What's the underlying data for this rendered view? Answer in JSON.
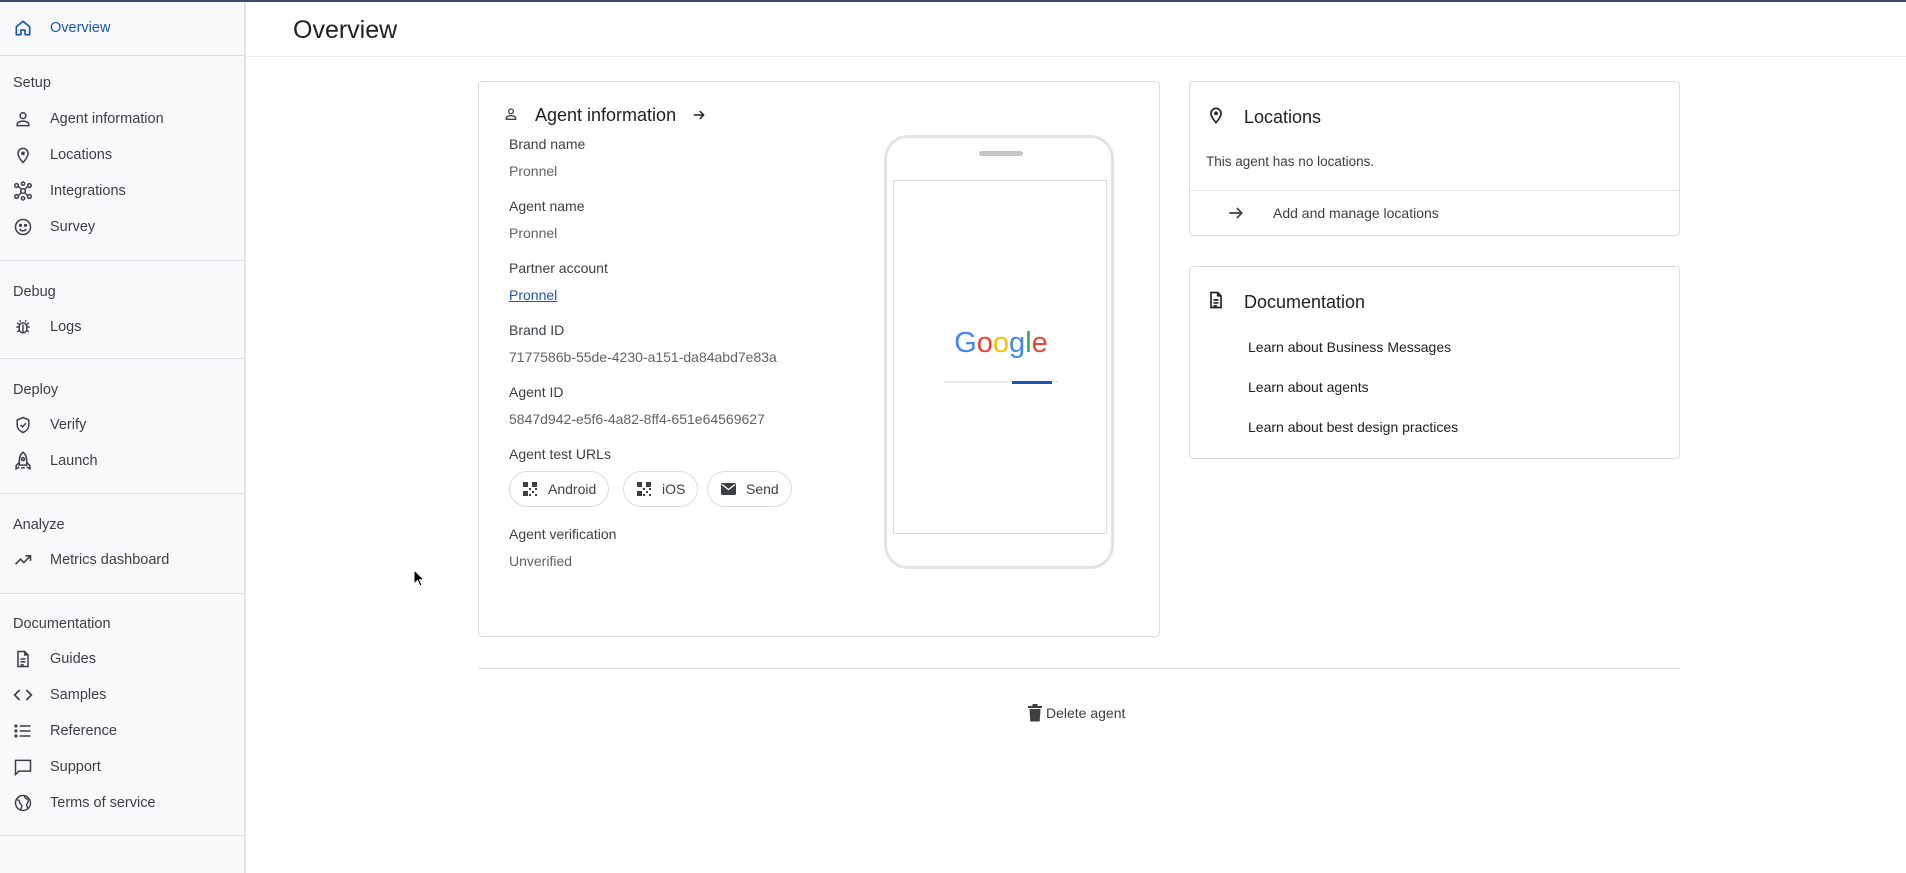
{
  "sidebar": {
    "overview": "Overview",
    "sections": {
      "setup": "Setup",
      "debug": "Debug",
      "deploy": "Deploy",
      "analyze": "Analyze",
      "documentation": "Documentation"
    },
    "items": {
      "agent_information": "Agent information",
      "locations": "Locations",
      "integrations": "Integrations",
      "survey": "Survey",
      "logs": "Logs",
      "verify": "Verify",
      "launch": "Launch",
      "metrics_dashboard": "Metrics dashboard",
      "guides": "Guides",
      "samples": "Samples",
      "reference": "Reference",
      "support": "Support",
      "terms_of_service": "Terms of service"
    }
  },
  "header": {
    "title": "Overview"
  },
  "agent_card": {
    "title": "Agent information",
    "brand_name_label": "Brand name",
    "brand_name": "Pronnel",
    "agent_name_label": "Agent name",
    "agent_name": "Pronnel",
    "partner_account_label": "Partner account",
    "partner_account": "Pronnel",
    "brand_id_label": "Brand ID",
    "brand_id": "7177586b-55de-4230-a151-da84abd7e83a",
    "agent_id_label": "Agent ID",
    "agent_id": "5847d942-e5f6-4a82-8ff4-651e64569627",
    "test_urls_label": "Agent test URLs",
    "test_urls": {
      "android": "Android",
      "ios": "iOS",
      "send": "Send"
    },
    "verification_label": "Agent verification",
    "verification": "Unverified",
    "phone_preview": {
      "logo_letters": [
        "G",
        "o",
        "o",
        "g",
        "l",
        "e"
      ],
      "loading_progress": 0.35
    }
  },
  "locations_card": {
    "title": "Locations",
    "empty_text": "This agent has no locations.",
    "action": "Add and manage locations"
  },
  "documentation_card": {
    "title": "Documentation",
    "links": [
      "Learn about Business Messages",
      "Learn about agents",
      "Learn about best design practices"
    ]
  },
  "footer": {
    "delete_label": "Delete agent"
  },
  "colors": {
    "accent": "#1a56b8",
    "google_blue": "#4285f4",
    "google_red": "#ea4335",
    "google_yellow": "#fbbc05",
    "google_green": "#34a853"
  }
}
